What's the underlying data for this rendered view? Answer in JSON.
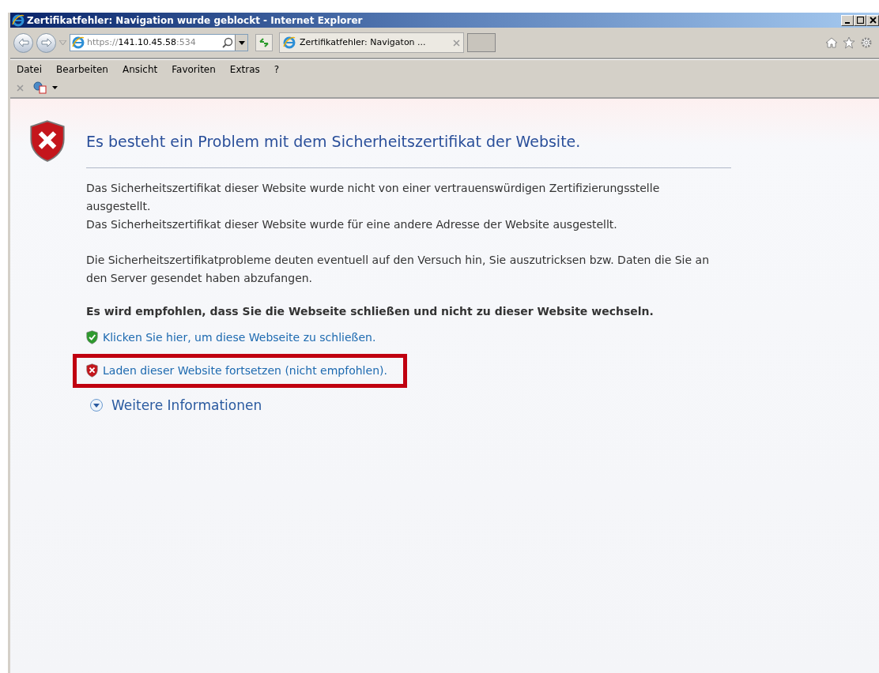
{
  "window": {
    "title": "Zertifikatfehler: Navigation wurde geblockt - Internet Explorer"
  },
  "address_bar": {
    "url": "https://**141.10.45.58**:534"
  },
  "tabs": [
    {
      "label": "Zertifikatfehler: Navigaton ...",
      "selected": true
    }
  ],
  "menu": [
    "Datei",
    "Bearbeiten",
    "Ansicht",
    "Favoriten",
    "Extras",
    "?"
  ],
  "page": {
    "heading": "Es besteht ein Problem mit dem Sicherheitszertifikat der Website.",
    "paragraphs": [
      [
        "Das Sicherheitszertifikat dieser Website wurde nicht von einer vertrauenswürdigen Zertifizierungsstelle ausgestellt.",
        "Das Sicherheitszertifikat dieser Website wurde für eine andere Adresse der Website ausgestellt."
      ],
      [
        "Die Sicherheitszertifikatprobleme deuten eventuell auf den Versuch hin, Sie auszutricksen bzw. Daten die Sie an den Server gesendet haben abzufangen."
      ]
    ],
    "recommendation": "Es wird empfohlen, dass Sie die Webseite schließen und nicht zu dieser Website wechseln.",
    "links": [
      {
        "kind": "safe",
        "label": "Klicken Sie hier, um diese Webseite zu schließen.",
        "highlighted": false
      },
      {
        "kind": "unsafe",
        "label": "Laden dieser Website fortsetzen (nicht empfohlen).",
        "highlighted": true
      }
    ],
    "more_info": {
      "label": "Weitere Informationen",
      "expanded": false
    }
  }
}
